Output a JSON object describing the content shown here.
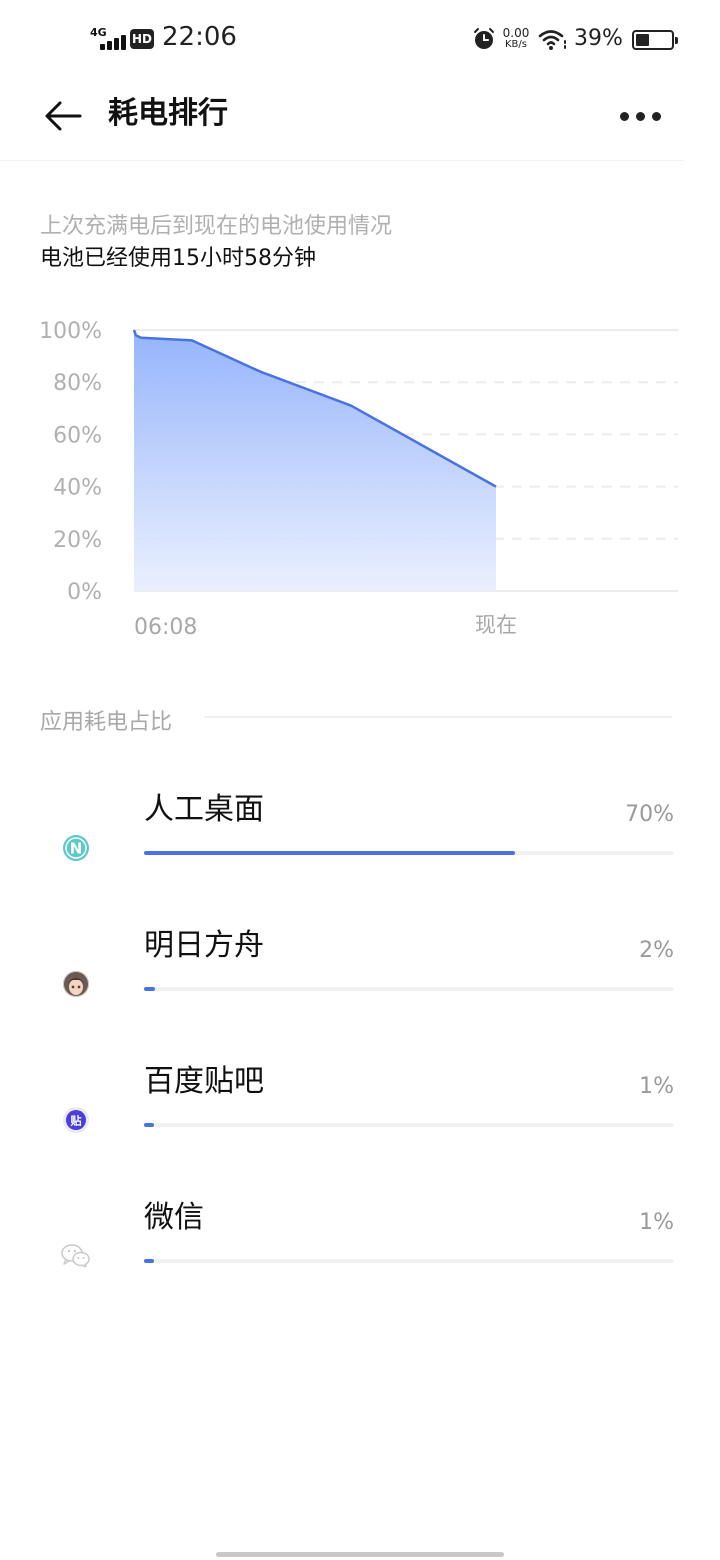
{
  "status_bar": {
    "network": "4G",
    "hd": "HD",
    "time": "22:06",
    "net_speed_value": "0.00",
    "net_speed_unit": "KB/s",
    "battery_percent": "39%",
    "battery_level": 0.39
  },
  "header": {
    "title": "耗电排行",
    "back_icon": "arrow-left-icon",
    "more_icon": "more-horizontal-icon"
  },
  "summary": {
    "description": "上次充满电后到现在的电池使用情况",
    "used_time": "电池已经使用15小时58分钟"
  },
  "chart_data": {
    "type": "area",
    "y_ticks": [
      "100%",
      "80%",
      "60%",
      "40%",
      "20%",
      "0%"
    ],
    "ylim": [
      0,
      100
    ],
    "x_labels": [
      "06:08",
      "现在"
    ],
    "points": [
      {
        "t": 0.0,
        "y": 100
      },
      {
        "t": 0.005,
        "y": 98
      },
      {
        "t": 0.02,
        "y": 97
      },
      {
        "t": 0.16,
        "y": 96
      },
      {
        "t": 0.35,
        "y": 84
      },
      {
        "t": 0.6,
        "y": 71
      },
      {
        "t": 1.0,
        "y": 40
      }
    ],
    "grid": true,
    "accent_color": "#4a72e0"
  },
  "section": {
    "title": "应用耗电占比"
  },
  "apps": [
    {
      "name": "人工桌面",
      "percent_label": "70%",
      "percent": 70,
      "icon": "n-launcher-icon"
    },
    {
      "name": "明日方舟",
      "percent_label": "2%",
      "percent": 2,
      "icon": "arknights-avatar-icon"
    },
    {
      "name": "百度贴吧",
      "percent_label": "1%",
      "percent": 1,
      "icon": "tieba-icon"
    },
    {
      "name": "微信",
      "percent_label": "1%",
      "percent": 1,
      "icon": "wechat-icon"
    }
  ]
}
